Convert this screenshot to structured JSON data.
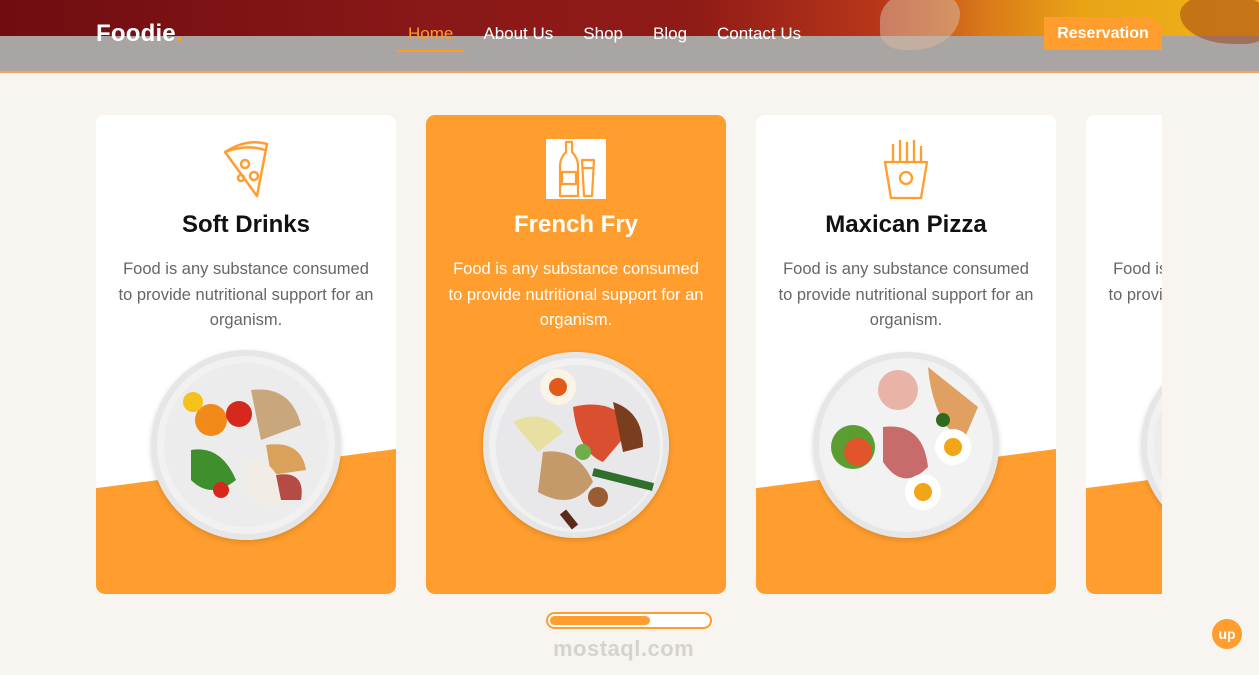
{
  "brand": {
    "name": "Foodie",
    "dot": "."
  },
  "nav": {
    "items": [
      {
        "label": "Home",
        "active": true
      },
      {
        "label": "About Us"
      },
      {
        "label": "Shop"
      },
      {
        "label": "Blog"
      },
      {
        "label": "Contact Us"
      }
    ],
    "reservation_label": "Reservation"
  },
  "cards": [
    {
      "icon": "pizza-slice-icon",
      "title": "Soft Drinks",
      "description": "Food is any substance consumed to provide nutritional support for an organism."
    },
    {
      "icon": "bottles-icon",
      "title": "French Fry",
      "description": "Food is any substance consumed to provide nutritional support for an organism."
    },
    {
      "icon": "fries-icon",
      "title": "Maxican Pizza",
      "description": "Food is any substance consumed to provide nutritional support for an organism."
    },
    {
      "icon": "",
      "title": "",
      "description": "Food is any substance consumed to provide nutritional support for an organism."
    }
  ],
  "carousel": {
    "progress": 0.63
  },
  "watermark": "mostaql.com",
  "scroll_top_label": "up",
  "colors": {
    "accent": "#ff9d2e",
    "card_bg": "#ffffff",
    "page_bg": "#f8f5f1"
  }
}
